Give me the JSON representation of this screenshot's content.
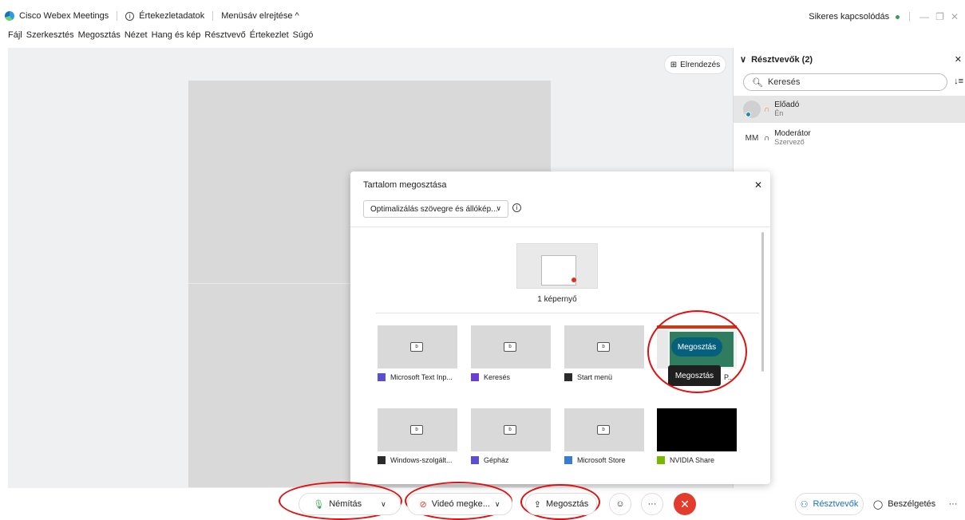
{
  "titlebar": {
    "app_name": "Cisco Webex Meetings",
    "meeting_info": "Értekezletadatok",
    "hide_menu": "Menüsáv elrejtése ^",
    "status": "Sikeres kapcsolódás",
    "minimize": "—",
    "maximize": "❐",
    "close": "✕"
  },
  "menu": [
    "Fájl",
    "Szerkesztés",
    "Megosztás",
    "Nézet",
    "Hang és kép",
    "Résztvevő",
    "Értekezlet",
    "Súgó"
  ],
  "stage": {
    "layout_label": "Elrendezés"
  },
  "participants_panel": {
    "title": "Résztvevők (2)",
    "search_placeholder": "Keresés",
    "participants": [
      {
        "name": "Előadó",
        "role": "Én",
        "initials": ""
      },
      {
        "name": "Moderátor",
        "role": "Szervező",
        "initials": "MM"
      }
    ]
  },
  "share_dialog": {
    "title": "Tartalom megosztása",
    "optimize_value": "Optimalizálás szövegre és állókép...",
    "screen_label": "1 képernyő",
    "apps": [
      {
        "label": "Microsoft Text Inp...",
        "icon_color": "#5b4fd1"
      },
      {
        "label": "Keresés",
        "icon_color": "#6a3fd0"
      },
      {
        "label": "Start menü",
        "icon_color": "#2b2b2b"
      },
      {
        "label": "P...",
        "icon_color": "#c43e1c"
      },
      {
        "label": "Windows-szolgált...",
        "icon_color": "#2b2b2b"
      },
      {
        "label": "Gépház",
        "icon_color": "#5b4fd1"
      },
      {
        "label": "Microsoft Store",
        "icon_color": "#3a7bd5"
      },
      {
        "label": "NVIDIA Share",
        "icon_color": "#76b900"
      }
    ],
    "share_button": "Megosztás",
    "share_tooltip": "Megosztás"
  },
  "toolbar": {
    "mute_label": "Némítás",
    "video_label": "Videó megke...",
    "share_label": "Megosztás",
    "participants_label": "Résztvevők",
    "chat_label": "Beszélgetés",
    "more": "···",
    "end": "✕",
    "reactions": "☺"
  },
  "colors": {
    "accent": "#06607c",
    "end_red": "#e23c2e",
    "annotation_red": "#e01010"
  }
}
